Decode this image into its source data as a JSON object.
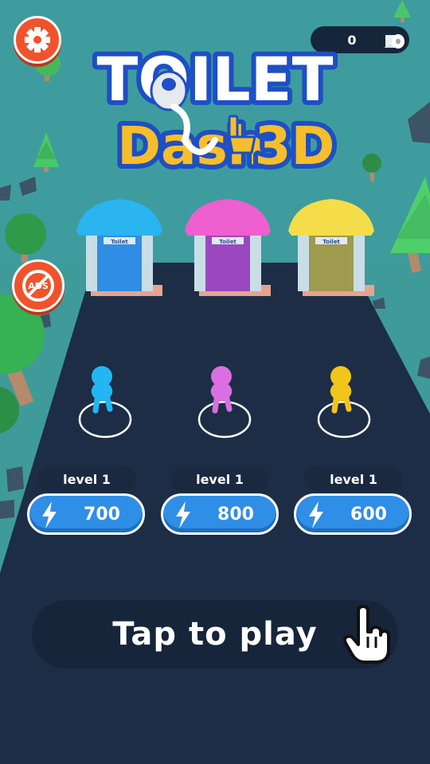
{
  "game": {
    "title_line1": "TOILET",
    "title_line2": "Dash",
    "title_suffix": "3D"
  },
  "hud": {
    "currency_value": "0",
    "currency_icon": "toilet-paper-icon",
    "settings_icon": "gear-icon",
    "no_ads_icon": "no-ads-icon",
    "no_ads_text": "ADS"
  },
  "booths": [
    {
      "sign": "Toilet",
      "roof_color": "#2ab4f0",
      "door_color": "#2f8de4"
    },
    {
      "sign": "Toilet",
      "roof_color": "#ee5fcf",
      "door_color": "#9b48c0"
    },
    {
      "sign": "Toilet",
      "roof_color": "#f5dd4a",
      "door_color": "#9e9a4e"
    }
  ],
  "characters": [
    {
      "color": "#22b7f2",
      "level": "level 1",
      "price": "700"
    },
    {
      "color": "#d96fe0",
      "level": "level 1",
      "price": "800"
    },
    {
      "color": "#f2c51b",
      "level": "level 1",
      "price": "600"
    }
  ],
  "play": {
    "label": "Tap to play",
    "icon": "tap-hand-icon"
  },
  "colors": {
    "ground": "#3f9a9a",
    "road": "#1d2d46",
    "accent_orange": "#f0532c",
    "button_blue": "#2f8ee6"
  }
}
